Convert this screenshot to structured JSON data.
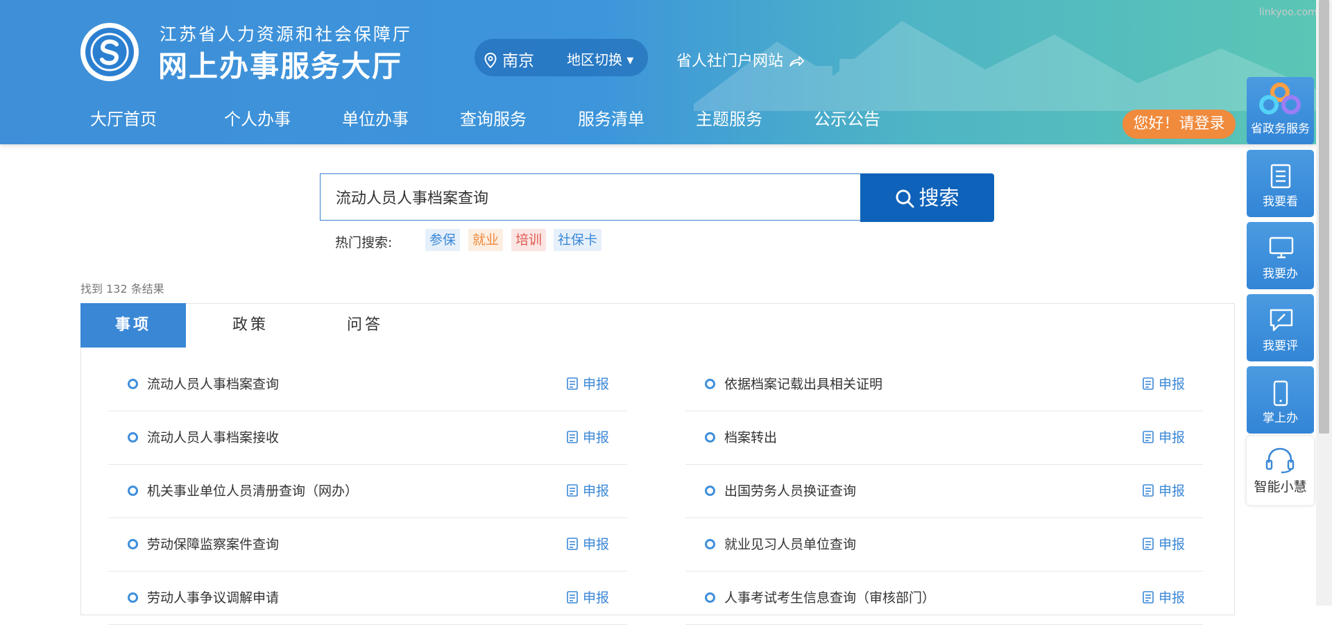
{
  "header": {
    "org_name": "江苏省人力资源和社会保障厅",
    "hall_name": "网上办事服务大厅",
    "region": "南京",
    "region_switch": "地区切换 ▾",
    "portal_link": "省人社门户网站",
    "login": "您好！请登录",
    "watermark": "linkyoo.com"
  },
  "nav": [
    "大厅首页",
    "个人办事",
    "单位办事",
    "查询服务",
    "服务清单",
    "主题服务",
    "公示公告"
  ],
  "search": {
    "value": "流动人员人事档案查询",
    "button_label": "搜索",
    "hot_label": "热门搜索:",
    "hot_tags": [
      {
        "label": "参保",
        "color": "#3a87d6",
        "bg": "#e6f0fb"
      },
      {
        "label": "就业",
        "color": "#f08a3c",
        "bg": "#fdeee2"
      },
      {
        "label": "培训",
        "color": "#e0594f",
        "bg": "#fbe5e3"
      },
      {
        "label": "社保卡",
        "color": "#3a87d6",
        "bg": "#e6f0fb"
      }
    ]
  },
  "results": {
    "count_text": "找到  132  条结果",
    "tabs": [
      "事项",
      "政策",
      "问答"
    ],
    "apply_label": "申报",
    "left_items": [
      "流动人员人事档案查询",
      "流动人员人事档案接收",
      "机关事业单位人员清册查询（网办）",
      "劳动保障监察案件查询",
      "劳动人事争议调解申请"
    ],
    "right_items": [
      "依据档案记载出具相关证明",
      "档案转出",
      "出国劳务人员换证查询",
      "就业见习人员单位查询",
      "人事考试考生信息查询（审核部门）"
    ]
  },
  "sidebar": {
    "gov_service": "省政务服务",
    "view": "我要看",
    "handle": "我要办",
    "review": "我要评",
    "mobile": "掌上办",
    "assistant": "智能小慧"
  },
  "colors": {
    "brand_blue": "#3a87d6",
    "search_button": "#0e62b9",
    "login_orange": "#f08a3c"
  }
}
